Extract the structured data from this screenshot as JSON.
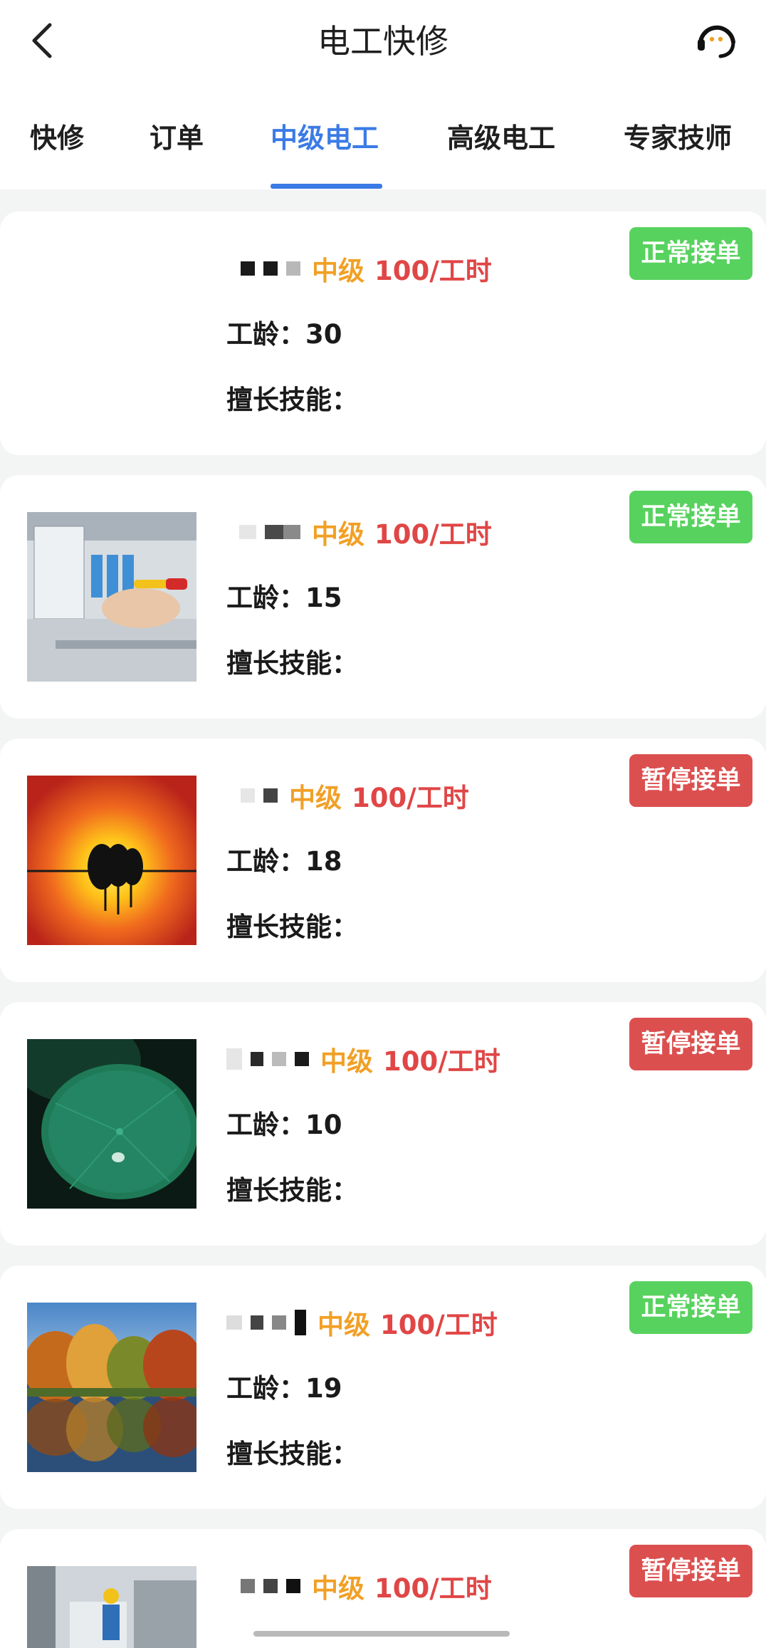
{
  "header": {
    "title": "电工快修",
    "back_icon": "back-arrow-icon",
    "service_icon": "customer-service-icon"
  },
  "tabs": [
    {
      "label": "快修",
      "active": false
    },
    {
      "label": "订单",
      "active": false
    },
    {
      "label": "中级电工",
      "active": true
    },
    {
      "label": "高级电工",
      "active": false
    },
    {
      "label": "专家技师",
      "active": false
    }
  ],
  "colors": {
    "accent": "#3b7be6",
    "level": "#f1a026",
    "price": "#e04646",
    "status_normal": "#58d25f",
    "status_paused": "#dc4f4f"
  },
  "cards": [
    {
      "level": "中级",
      "price": "100/工时",
      "age_label": "工龄：",
      "age": "30",
      "skill_label": "擅长技能：",
      "status": "正常接单"
    },
    {
      "level": "中级",
      "price": "100/工时",
      "age_label": "工龄：",
      "age": "15",
      "skill_label": "擅长技能：",
      "status": "正常接单"
    },
    {
      "level": "中级",
      "price": "100/工时",
      "age_label": "工龄：",
      "age": "18",
      "skill_label": "擅长技能：",
      "status": "暂停接单"
    },
    {
      "level": "中级",
      "price": "100/工时",
      "age_label": "工龄：",
      "age": "10",
      "skill_label": "擅长技能：",
      "status": "暂停接单"
    },
    {
      "level": "中级",
      "price": "100/工时",
      "age_label": "工龄：",
      "age": "19",
      "skill_label": "擅长技能：",
      "status": "正常接单"
    },
    {
      "level": "中级",
      "price": "100/工时",
      "status": "暂停接单"
    }
  ]
}
